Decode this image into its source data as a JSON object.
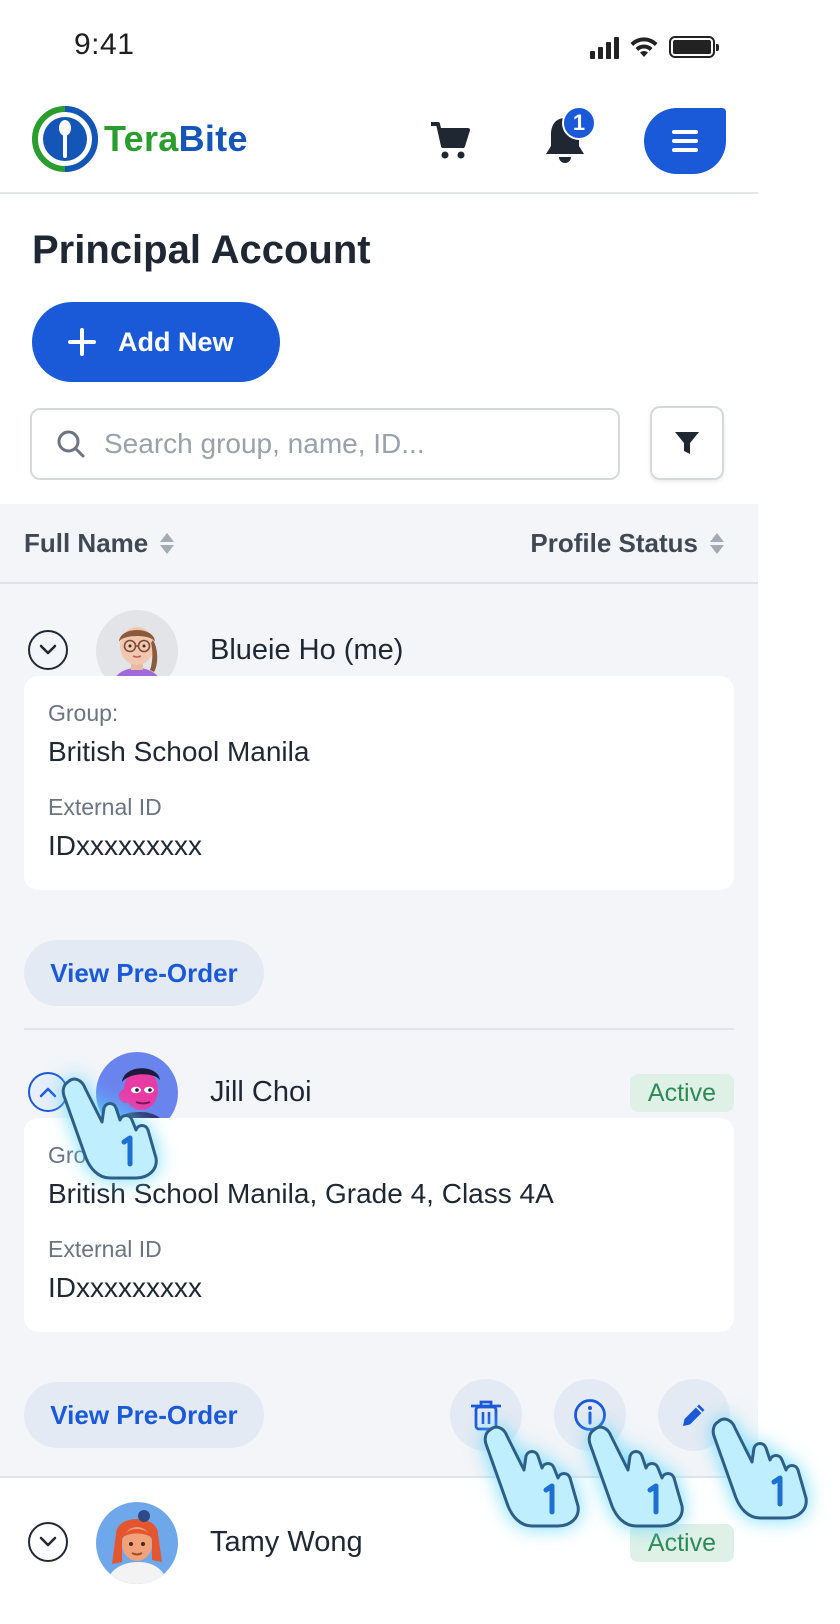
{
  "status_bar": {
    "time": "9:41"
  },
  "header": {
    "logo_text_part1": "Tera",
    "logo_text_part2": "Bite",
    "notification_count": "1",
    "brand_colors": {
      "primary": "#1a5ad8",
      "green": "#2a9d2e"
    }
  },
  "page": {
    "title": "Principal Account",
    "add_new_label": "Add New",
    "search_placeholder": "Search group, name, ID...",
    "search_value": ""
  },
  "table": {
    "columns": [
      {
        "label": "Full Name"
      },
      {
        "label": "Profile Status"
      }
    ],
    "rows": [
      {
        "name": "Blueie Ho (me)",
        "status": "",
        "expanded": true,
        "group_label": "Group:",
        "group_value": "British School Manila",
        "external_id_label": "External ID",
        "external_id_value": "IDxxxxxxxxx",
        "preorder_label": "View Pre-Order"
      },
      {
        "name": "Jill Choi",
        "status": "Active",
        "expanded": true,
        "group_label": "Group:",
        "group_value": "British School Manila, Grade 4, Class 4A",
        "external_id_label": "External ID",
        "external_id_value": "IDxxxxxxxxx",
        "preorder_label": "View Pre-Order",
        "actions": [
          "trash-icon",
          "info-icon",
          "pencil-icon"
        ]
      },
      {
        "name": "Tamy Wong",
        "status": "Active",
        "expanded": false
      }
    ]
  },
  "colors": {
    "active_badge_bg": "#dff1e7",
    "active_badge_text": "#2d8a57",
    "table_bg": "#f3f5f8"
  }
}
